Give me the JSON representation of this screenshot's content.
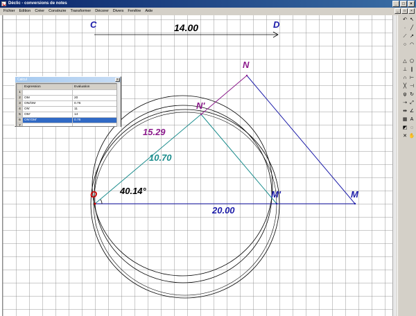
{
  "window": {
    "title": "Déclic - conversions de notes",
    "controls": [
      "_",
      "□",
      "×"
    ]
  },
  "menubar": {
    "items": [
      "Fichier",
      "Edition",
      "Créer",
      "Construire",
      "Transformer",
      "Décorer",
      "Divers",
      "Fenêtre",
      "Aide"
    ],
    "right_controls": [
      "_",
      "□",
      "×"
    ]
  },
  "calc_window": {
    "title": "Calcul",
    "close": "×",
    "headers": [
      "Expression",
      "Evaluation"
    ],
    "rows": [
      {
        "index": "1",
        "expression": "",
        "evaluation": ""
      },
      {
        "index": "2",
        "expression": "OM",
        "evaluation": "20"
      },
      {
        "index": "3",
        "expression": "ON/OM",
        "evaluation": "0.76"
      },
      {
        "index": "4",
        "expression": "ON'",
        "evaluation": "11"
      },
      {
        "index": "5",
        "expression": "OM'",
        "evaluation": "14"
      },
      {
        "index": "6",
        "expression": "ON'/OM'",
        "evaluation": "0.76"
      },
      {
        "index": "7",
        "expression": "",
        "evaluation": ""
      }
    ],
    "selected_row": 5
  },
  "figure": {
    "points": {
      "C": "C",
      "D": "D",
      "N": "N",
      "N_prime": "N'",
      "O": "O",
      "M_prime": "M'",
      "M": "M"
    },
    "measures": {
      "CD": "14.00",
      "ON_prime_outer": "15.29",
      "ON_prime_inner": "10.70",
      "angle": "40.14°",
      "OM": "20.00"
    },
    "colors": {
      "blue": "#1a1aa8",
      "purple": "#8b1a8b",
      "teal": "#1a8c8c",
      "red": "#cc0000",
      "black": "#000000"
    }
  },
  "toolbar": {
    "icons": [
      "undo-icon",
      "pointer-icon",
      "point-icon",
      "line-icon",
      "segment-icon",
      "ray-icon",
      "circle-icon",
      "arc-icon",
      "polygon-icon",
      "triangle-icon",
      "perpendicular-icon",
      "parallel-icon",
      "midpoint-icon",
      "bisector-icon",
      "intersection-icon",
      "compass-icon",
      "reflection-icon",
      "rotation-icon",
      "translation-icon",
      "homothety-icon",
      "measure-icon",
      "angle-icon",
      "calculator-icon",
      "text-icon",
      "color-icon",
      "hide-icon",
      "delete-icon",
      "hand-icon"
    ]
  }
}
